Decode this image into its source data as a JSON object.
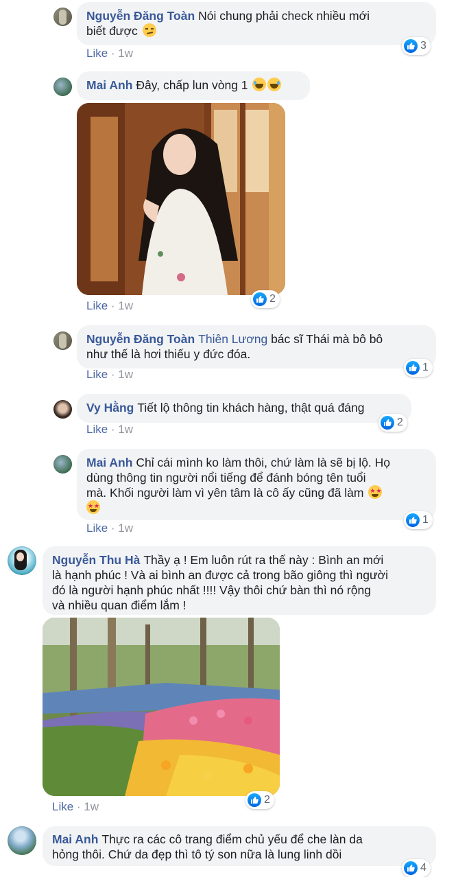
{
  "like_label": "Like",
  "comments": [
    {
      "name": "Nguyễn Đăng Toàn",
      "mention": "",
      "text_lines": [
        "Nói chung phải check nhiều mới",
        "biết được"
      ],
      "emoji": "smirk-emoji",
      "time": "1w",
      "reactions": "3"
    },
    {
      "name": "Mai Anh",
      "mention": "",
      "text_lines": [
        "Đây, chấp lun vòng 1"
      ],
      "emoji": "laugh-emoji",
      "time": "1w",
      "reactions": "2",
      "photo": "photo-girl-by-window"
    },
    {
      "name": "Nguyễn Đăng Toàn",
      "mention": "Thiên Lương",
      "text_lines": [
        "bác sĩ Thái mà bô bô",
        "như thế là hơi thiếu y đức đóa."
      ],
      "time": "1w",
      "reactions": "1"
    },
    {
      "name": "Vy Hằng",
      "mention": "",
      "text_lines": [
        "Tiết lộ thông tin khách hàng, thật quá đáng"
      ],
      "time": "1w",
      "reactions": "2"
    },
    {
      "name": "Mai Anh",
      "mention": "",
      "text_lines": [
        "Chỉ cái mình ko làm thôi, chứ làm là sẽ bị lộ. Họ",
        "dùng thông tin người nổi tiếng để đánh bóng tên tuổi",
        "mà. Khối người làm vì yên tâm là cô ấy cũng đã làm"
      ],
      "emoji": "star-struck-emoji",
      "time": "1w",
      "reactions": "1"
    },
    {
      "name": "Nguyễn Thu Hà",
      "mention": "",
      "text_lines": [
        "Thầy ạ ! Em luôn rút ra thế này : Bình an mới",
        "là hạnh phúc ! Và ai bình an được cả trong bão giông thì người",
        "đó là người hạnh phúc nhất !!!! Vậy thôi chứ bàn thì nó rộng",
        "và nhiều quan điểm lắm !"
      ],
      "time": "1w",
      "reactions": "2",
      "photo": "photo-tulip-garden"
    },
    {
      "name": "Mai Anh",
      "mention": "",
      "text_lines": [
        "Thực ra các cô trang điểm chủ yếu để che làn da",
        "hỏng thôi. Chứ da đẹp thì tô tý son nữa là lung linh dồi"
      ],
      "time": "",
      "reactions": "4"
    }
  ],
  "colors": {
    "name": "#385898",
    "bubble": "#f2f3f5",
    "like_blue": "#1877f2",
    "meta": "#90949c"
  }
}
